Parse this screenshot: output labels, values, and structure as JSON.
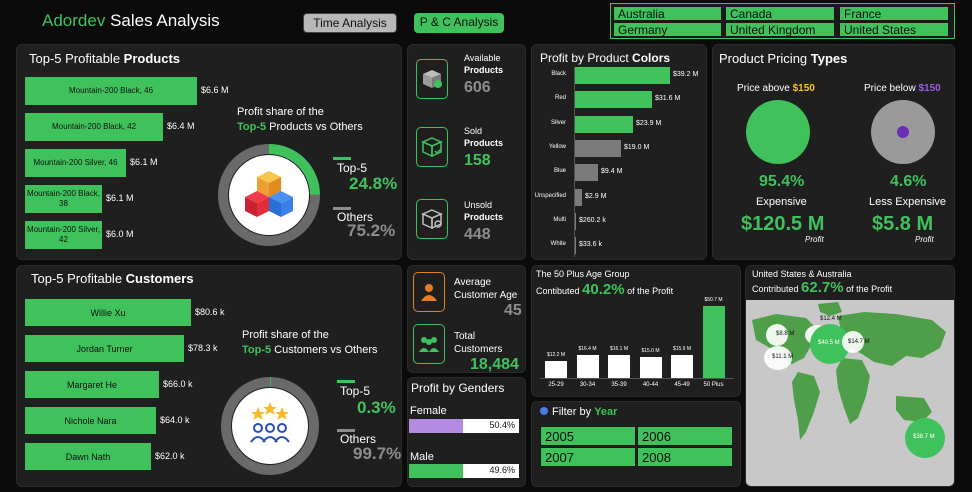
{
  "header": {
    "title_brand": "Adordev",
    "title_rest": "Sales Analysis",
    "tab_time": "Time Analysis",
    "tab_pc": "P & C Analysis"
  },
  "country_slicer": [
    "Australia",
    "Canada",
    "France",
    "Germany",
    "United Kingdom",
    "United States"
  ],
  "products": {
    "title_pre": "Top-5 Profitable ",
    "title_bold": "Products",
    "items": [
      {
        "name": "Mountain-200 Black, 46",
        "value": "$6.6 M",
        "share": 1.0
      },
      {
        "name": "Mountain-200 Black, 42",
        "value": "$6.4 M",
        "share": 0.8
      },
      {
        "name": "Mountain-200 Silver, 46",
        "value": "$6.1 M",
        "share": 0.59
      },
      {
        "name": "Mountain-200 Black, 38",
        "value": "$6.1 M",
        "share": 0.45
      },
      {
        "name": "Mountain-200 Silver, 42",
        "value": "$6.0 M",
        "share": 0.45
      }
    ],
    "share_line1": "Profit share of the",
    "share_bold": "Top-5",
    "share_line2": " Products vs Others",
    "top_label": "Top-5",
    "top_value": "24.8%",
    "top_fraction": 0.248,
    "others_label": "Others",
    "others_value": "75.2%"
  },
  "kpis": {
    "available_l1": "Available",
    "available_l2": "Products",
    "available_value": "606",
    "sold_l1": "Sold",
    "sold_l2": "Products",
    "sold_value": "158",
    "unsold_l1": "Unsold",
    "unsold_l2": "Products",
    "unsold_value": "448"
  },
  "colors_chart": {
    "title_pre": "Profit by Product ",
    "title_bold": "Colors",
    "categories": [
      "Black",
      "Red",
      "Silver",
      "Yellow",
      "Blue",
      "Unspecified",
      "Multi",
      "White"
    ],
    "labels": [
      "$39.2 M",
      "$31.6 M",
      "$23.9 M",
      "$19.0 M",
      "$9.4 M",
      "$2.9 M",
      "$260.2 k",
      "$33.6 k"
    ],
    "values": [
      39.2,
      31.6,
      23.9,
      19.0,
      9.4,
      2.9,
      0.26,
      0.0336
    ],
    "highlight": [
      true,
      true,
      true,
      false,
      false,
      false,
      false,
      false
    ]
  },
  "pricing": {
    "title_pre": "Product Pricing ",
    "title_bold": "Types",
    "above_pre": "Price above ",
    "above_val": "$150",
    "below_pre": "Price below ",
    "below_val": "$150",
    "above_pct": "95.4%",
    "above_label": "Expensive",
    "above_profit": "$120.5 M",
    "below_pct": "4.6%",
    "below_label": "Less Expensive",
    "below_profit": "$5.8 M",
    "profit_caption": "Profit"
  },
  "customers": {
    "title_pre": "Top-5 Profitable ",
    "title_bold": "Customers",
    "items": [
      {
        "name": "Willie Xu",
        "value": "$80.6 k",
        "share": 1.0
      },
      {
        "name": "Jordan Turner",
        "value": "$78.3 k",
        "share": 0.96
      },
      {
        "name": "Margaret He",
        "value": "$66.0 k",
        "share": 0.81
      },
      {
        "name": "Nichole Nara",
        "value": "$64.0 k",
        "share": 0.79
      },
      {
        "name": "Dawn Nath",
        "value": "$62.0 k",
        "share": 0.76
      }
    ],
    "share_line1": "Profit share of the",
    "share_bold": "Top-5",
    "share_line2": " Customers vs Others",
    "top_label": "Top-5",
    "top_value": "0.3%",
    "top_fraction": 0.003,
    "others_label": "Others",
    "others_value": "99.7%"
  },
  "age_kpi": {
    "label_l1": "Average",
    "label_l2": "Customer Age",
    "value": "45",
    "total_l1": "Total",
    "total_l2": "Customers",
    "total_value": "18,484"
  },
  "genders": {
    "title": "Profit by Genders",
    "female_label": "Female",
    "female_value": "50.4%",
    "female_fraction": 0.504,
    "male_label": "Male",
    "male_value": "49.6%",
    "male_fraction": 0.496
  },
  "age_chart": {
    "title": "The 50 Plus Age Group",
    "line2_pre": "Contibuted ",
    "line2_pct": "40.2%",
    "line2_post": " of the Profit",
    "categories": [
      "25-29",
      "30-34",
      "35-39",
      "40-44",
      "45-49",
      "50 Plus"
    ],
    "labels": [
      "$12.2 M",
      "$16.4 M",
      "$16.1 M",
      "$15.0 M",
      "$15.9 M",
      "$50.7 M"
    ],
    "values": [
      12.2,
      16.4,
      16.1,
      15.0,
      15.9,
      50.7
    ]
  },
  "year_filter": {
    "title_pre": "Filter by ",
    "title_bold": "Year",
    "years": [
      "2005",
      "2006",
      "2007",
      "2008"
    ]
  },
  "map": {
    "line1": "United States & Australia",
    "line2_pre": "Contributed ",
    "line2_pct": "62.7%",
    "line2_post": " of the Profit",
    "bubbles": [
      "$12.4 M",
      "$8.8 M",
      "$40.5 M",
      "$14.7 M",
      "$11.1 M",
      "$38.7 M"
    ]
  },
  "colors": {
    "accent": "#3fc25c",
    "purple": "#b48be0",
    "panel": "#1f1f1f"
  }
}
